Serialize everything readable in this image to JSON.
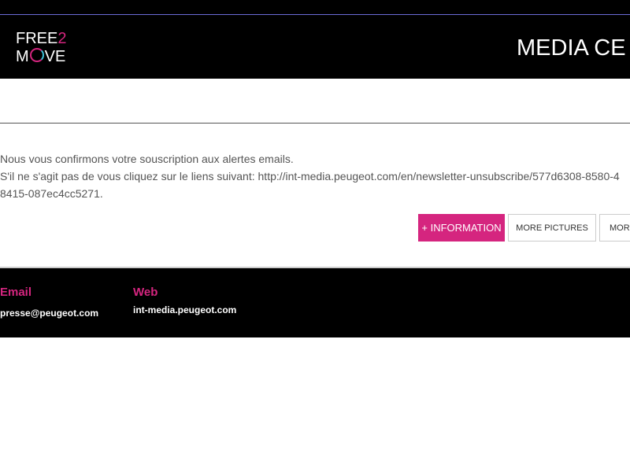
{
  "brand": {
    "logo_line1_a": "FREE",
    "logo_line1_b": "2",
    "logo_line2_a": "M",
    "logo_line2_b": "VE",
    "accent_color": "#d5257f",
    "secondary_color": "#3ec0d8"
  },
  "header": {
    "title": "MEDIA CE"
  },
  "message": {
    "line1": "Nous vous confirmons votre souscription aux alertes emails.",
    "line2": "S'il ne s'agit pas de vous cliquez sur le liens suivant: http://int-media.peugeot.com/en/newsletter-unsubscribe/577d6308-8580-4",
    "line3": "8415-087ec4cc5271."
  },
  "buttons": {
    "information": "+ INFORMATION",
    "more_pictures": "MORE PICTURES",
    "more": "MORE"
  },
  "footer": {
    "email_label": "Email",
    "email_value": "presse@peugeot.com",
    "web_label": "Web",
    "web_value": "int-media.peugeot.com"
  }
}
